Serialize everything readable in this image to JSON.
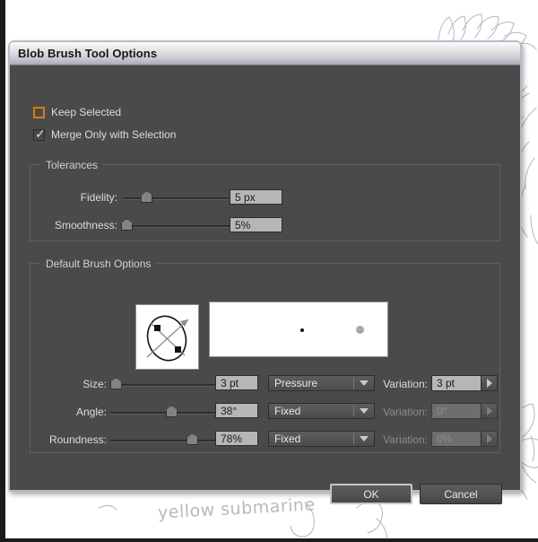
{
  "dialog": {
    "title": "Blob Brush Tool Options"
  },
  "checkboxes": [
    {
      "label": "Keep Selected",
      "checked": false,
      "focused": true,
      "icon": "checkbox-empty-icon"
    },
    {
      "label": "Merge Only with Selection",
      "checked": true,
      "focused": false,
      "icon": "checkmark-icon"
    }
  ],
  "tolerances": {
    "title": "Tolerances",
    "rows": [
      {
        "label": "Fidelity:",
        "value": "5 px",
        "slider_percent": 20
      },
      {
        "label": "Smoothness:",
        "value": "5%",
        "slider_percent": 3
      }
    ]
  },
  "brush_options": {
    "title": "Default Brush Options",
    "brush_icon": "ellipse-rotation-handles-icon",
    "preview_icon": "brush-stroke-preview",
    "rows": [
      {
        "label": "Size:",
        "value": "3 pt",
        "slider_percent": 5,
        "mode": "Pressure",
        "mode_disabled": false,
        "variation_label": "Variation:",
        "variation_value": "3 pt",
        "variation_disabled": false
      },
      {
        "label": "Angle:",
        "value": "38°",
        "slider_percent": 58,
        "mode": "Fixed",
        "mode_disabled": false,
        "variation_label": "Variation:",
        "variation_value": "0°",
        "variation_disabled": true
      },
      {
        "label": "Roundness:",
        "value": "78%",
        "slider_percent": 78,
        "mode": "Fixed",
        "mode_disabled": false,
        "variation_label": "Variation:",
        "variation_value": "0%",
        "variation_disabled": true
      }
    ]
  },
  "buttons": {
    "ok": "OK",
    "cancel": "Cancel"
  },
  "background": {
    "handwriting": "yellow submarine",
    "artwork": "pencil-sketch-flowers"
  },
  "colors": {
    "dialog_bg": "#4a4a4a",
    "titlebar_light": "#fbfbfd",
    "titlebar_dark": "#a6a6b5",
    "focus_orange": "#d97b12",
    "field_bg": "#b6b6b6",
    "text": "#dcdcdc"
  }
}
